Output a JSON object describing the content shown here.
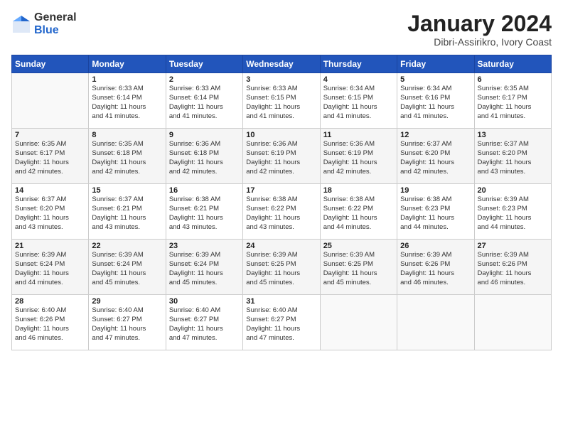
{
  "header": {
    "logo_general": "General",
    "logo_blue": "Blue",
    "title": "January 2024",
    "subtitle": "Dibri-Assirikro, Ivory Coast"
  },
  "columns": [
    "Sunday",
    "Monday",
    "Tuesday",
    "Wednesday",
    "Thursday",
    "Friday",
    "Saturday"
  ],
  "weeks": [
    [
      {
        "day": "",
        "info": ""
      },
      {
        "day": "1",
        "info": "Sunrise: 6:33 AM\nSunset: 6:14 PM\nDaylight: 11 hours\nand 41 minutes."
      },
      {
        "day": "2",
        "info": "Sunrise: 6:33 AM\nSunset: 6:14 PM\nDaylight: 11 hours\nand 41 minutes."
      },
      {
        "day": "3",
        "info": "Sunrise: 6:33 AM\nSunset: 6:15 PM\nDaylight: 11 hours\nand 41 minutes."
      },
      {
        "day": "4",
        "info": "Sunrise: 6:34 AM\nSunset: 6:15 PM\nDaylight: 11 hours\nand 41 minutes."
      },
      {
        "day": "5",
        "info": "Sunrise: 6:34 AM\nSunset: 6:16 PM\nDaylight: 11 hours\nand 41 minutes."
      },
      {
        "day": "6",
        "info": "Sunrise: 6:35 AM\nSunset: 6:17 PM\nDaylight: 11 hours\nand 41 minutes."
      }
    ],
    [
      {
        "day": "7",
        "info": "Sunrise: 6:35 AM\nSunset: 6:17 PM\nDaylight: 11 hours\nand 42 minutes."
      },
      {
        "day": "8",
        "info": "Sunrise: 6:35 AM\nSunset: 6:18 PM\nDaylight: 11 hours\nand 42 minutes."
      },
      {
        "day": "9",
        "info": "Sunrise: 6:36 AM\nSunset: 6:18 PM\nDaylight: 11 hours\nand 42 minutes."
      },
      {
        "day": "10",
        "info": "Sunrise: 6:36 AM\nSunset: 6:19 PM\nDaylight: 11 hours\nand 42 minutes."
      },
      {
        "day": "11",
        "info": "Sunrise: 6:36 AM\nSunset: 6:19 PM\nDaylight: 11 hours\nand 42 minutes."
      },
      {
        "day": "12",
        "info": "Sunrise: 6:37 AM\nSunset: 6:20 PM\nDaylight: 11 hours\nand 42 minutes."
      },
      {
        "day": "13",
        "info": "Sunrise: 6:37 AM\nSunset: 6:20 PM\nDaylight: 11 hours\nand 43 minutes."
      }
    ],
    [
      {
        "day": "14",
        "info": "Sunrise: 6:37 AM\nSunset: 6:20 PM\nDaylight: 11 hours\nand 43 minutes."
      },
      {
        "day": "15",
        "info": "Sunrise: 6:37 AM\nSunset: 6:21 PM\nDaylight: 11 hours\nand 43 minutes."
      },
      {
        "day": "16",
        "info": "Sunrise: 6:38 AM\nSunset: 6:21 PM\nDaylight: 11 hours\nand 43 minutes."
      },
      {
        "day": "17",
        "info": "Sunrise: 6:38 AM\nSunset: 6:22 PM\nDaylight: 11 hours\nand 43 minutes."
      },
      {
        "day": "18",
        "info": "Sunrise: 6:38 AM\nSunset: 6:22 PM\nDaylight: 11 hours\nand 44 minutes."
      },
      {
        "day": "19",
        "info": "Sunrise: 6:38 AM\nSunset: 6:23 PM\nDaylight: 11 hours\nand 44 minutes."
      },
      {
        "day": "20",
        "info": "Sunrise: 6:39 AM\nSunset: 6:23 PM\nDaylight: 11 hours\nand 44 minutes."
      }
    ],
    [
      {
        "day": "21",
        "info": "Sunrise: 6:39 AM\nSunset: 6:24 PM\nDaylight: 11 hours\nand 44 minutes."
      },
      {
        "day": "22",
        "info": "Sunrise: 6:39 AM\nSunset: 6:24 PM\nDaylight: 11 hours\nand 45 minutes."
      },
      {
        "day": "23",
        "info": "Sunrise: 6:39 AM\nSunset: 6:24 PM\nDaylight: 11 hours\nand 45 minutes."
      },
      {
        "day": "24",
        "info": "Sunrise: 6:39 AM\nSunset: 6:25 PM\nDaylight: 11 hours\nand 45 minutes."
      },
      {
        "day": "25",
        "info": "Sunrise: 6:39 AM\nSunset: 6:25 PM\nDaylight: 11 hours\nand 45 minutes."
      },
      {
        "day": "26",
        "info": "Sunrise: 6:39 AM\nSunset: 6:26 PM\nDaylight: 11 hours\nand 46 minutes."
      },
      {
        "day": "27",
        "info": "Sunrise: 6:39 AM\nSunset: 6:26 PM\nDaylight: 11 hours\nand 46 minutes."
      }
    ],
    [
      {
        "day": "28",
        "info": "Sunrise: 6:40 AM\nSunset: 6:26 PM\nDaylight: 11 hours\nand 46 minutes."
      },
      {
        "day": "29",
        "info": "Sunrise: 6:40 AM\nSunset: 6:27 PM\nDaylight: 11 hours\nand 47 minutes."
      },
      {
        "day": "30",
        "info": "Sunrise: 6:40 AM\nSunset: 6:27 PM\nDaylight: 11 hours\nand 47 minutes."
      },
      {
        "day": "31",
        "info": "Sunrise: 6:40 AM\nSunset: 6:27 PM\nDaylight: 11 hours\nand 47 minutes."
      },
      {
        "day": "",
        "info": ""
      },
      {
        "day": "",
        "info": ""
      },
      {
        "day": "",
        "info": ""
      }
    ]
  ]
}
